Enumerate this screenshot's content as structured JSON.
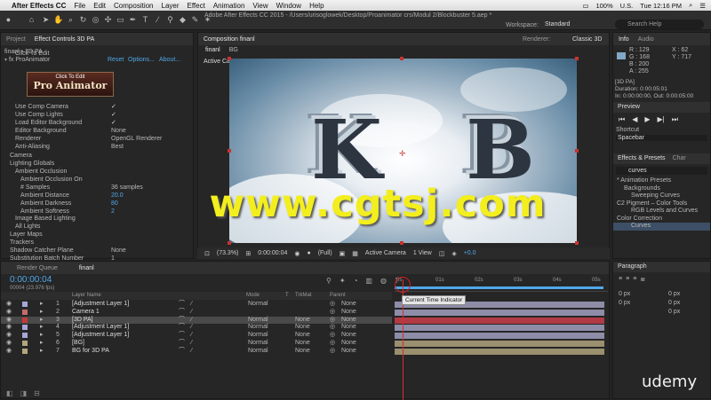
{
  "menubar": {
    "app": "After Effects CC",
    "items": [
      "File",
      "Edit",
      "Composition",
      "Layer",
      "Effect",
      "Animation",
      "View",
      "Window",
      "Help"
    ],
    "right": {
      "battery": "100%",
      "lang": "U.S.",
      "day_time": "Tue 12:16 PM"
    }
  },
  "toolbar": {
    "window_title": "Adobe After Effects CC 2015 - /Users/urisoglowek/Desktop/Proanimator crs/Modul 2/Blockbuster 5.aep *",
    "workspace_label": "Workspace:",
    "workspace_value": "Standard",
    "search_placeholder": "Search Help"
  },
  "left_panel": {
    "tab_project": "Project",
    "tab_effect_controls": "Effect Controls 3D PA",
    "layer_path": "finanl • 3D PA",
    "effect_name": "ProAnimator",
    "reset": "Reset",
    "options": "Options...",
    "about": "About...",
    "rows": [
      {
        "label": "Click To Edit",
        "value": ""
      },
      {
        "label": "Use Comp Camera",
        "value": "✓"
      },
      {
        "label": "Use Comp Lights",
        "value": "✓"
      },
      {
        "label": "Load Editor Background",
        "value": "✓"
      },
      {
        "label": "Editor Background",
        "value": "None"
      },
      {
        "label": "Renderer",
        "value": "OpenGL Renderer"
      },
      {
        "label": "Anti-Aliasing",
        "value": "Best"
      },
      {
        "label": "Camera",
        "value": ""
      },
      {
        "label": "Lighting Globals",
        "value": ""
      },
      {
        "label": "Ambient Occlusion",
        "value": ""
      },
      {
        "label": "Ambient Occlusion On",
        "value": ""
      },
      {
        "label": "# Samples",
        "value": "36 samples"
      },
      {
        "label": "Ambient Distance",
        "value": "20.0"
      },
      {
        "label": "Ambient Darkness",
        "value": "80"
      },
      {
        "label": "Ambient Softness",
        "value": "2"
      },
      {
        "label": "Image Based Lighting",
        "value": ""
      },
      {
        "label": "All Lights",
        "value": ""
      },
      {
        "label": "Layer Maps",
        "value": ""
      },
      {
        "label": "Trackers",
        "value": ""
      },
      {
        "label": "Shadow Catcher Plane",
        "value": "None"
      },
      {
        "label": "Substitution Batch Number",
        "value": "1"
      }
    ],
    "click_edit_top": "Click To Edit",
    "click_edit_logo": "Pro Animator"
  },
  "comp": {
    "tab_label": "Composition finanl",
    "view_tab": "finanl",
    "bg_tab": "BG",
    "active_camera": "Active Camera",
    "renderer_label": "Renderer:",
    "renderer_value": "Classic 3D",
    "footer": {
      "zoom": "(73.3%)",
      "time": "0:00:00:04",
      "res": "(Full)",
      "camera": "Active Camera",
      "views": "1 View",
      "exposure": "+0.0"
    },
    "letter_k": "K",
    "letter_b": "B",
    "watermark": "www.cgtsj.com"
  },
  "info": {
    "tab_info": "Info",
    "tab_audio": "Audio",
    "r": "R : 129",
    "g": "G : 168",
    "b": "B : 200",
    "a": "A : 255",
    "x": "X : 62",
    "y": "Y : 717",
    "layer": "[3D PA]",
    "duration": "Duration: 0:00:05:01",
    "inout": "In: 0:00:00:00, Out: 0:00:05:00",
    "color": "#81a8c8"
  },
  "preview": {
    "title": "Preview",
    "shortcut_label": "Shortcut",
    "shortcut_value": "Spacebar"
  },
  "effects": {
    "title": "Effects & Presets",
    "tab2": "Char",
    "search_value": "curves",
    "items": [
      {
        "label": "* Animation Presets",
        "indent": 0
      },
      {
        "label": "Backgrounds",
        "indent": 1
      },
      {
        "label": "Sweeping Curves",
        "indent": 2
      },
      {
        "label": "C2 Pigment – Color Tools",
        "indent": 0
      },
      {
        "label": "RGB Levels and Curves",
        "indent": 2
      },
      {
        "label": "Color Correction",
        "indent": 0
      },
      {
        "label": "Curves",
        "indent": 2
      }
    ]
  },
  "timeline": {
    "tab_render": "Render Queue",
    "tab_comp": "finanl",
    "time": "0:00:00:04",
    "frames": "00004 (23.976 fps)",
    "headers": {
      "layer_name": "Layer Name",
      "mode": "Mode",
      "t": "T",
      "trkmat": "TrkMat",
      "parent": "Parent"
    },
    "ruler": [
      "0s",
      "01s",
      "02s",
      "03s",
      "04s",
      "05s"
    ],
    "tooltip": "Current Time Indicator",
    "layers": [
      {
        "num": "1",
        "name": "[Adjustment Layer 1]",
        "mode": "Normal",
        "trkmat": "",
        "parent": "None",
        "color": "#a6a6d8",
        "track": "#8d8da8"
      },
      {
        "num": "2",
        "name": "Camera 1",
        "mode": "",
        "trkmat": "",
        "parent": "None",
        "color": "#c46b6b",
        "track": "#8d8da8"
      },
      {
        "num": "3",
        "name": "[3D PA]",
        "mode": "Normal",
        "trkmat": "None",
        "parent": "None",
        "color": "#c43a3a",
        "track": "#b23a45"
      },
      {
        "num": "4",
        "name": "[Adjustment Layer 1]",
        "mode": "Normal",
        "trkmat": "None",
        "parent": "None",
        "color": "#a6a6d8",
        "track": "#8d8da8"
      },
      {
        "num": "5",
        "name": "[Adjustment Layer 1]",
        "mode": "Normal",
        "trkmat": "None",
        "parent": "None",
        "color": "#a6a6d8",
        "track": "#8d8da8"
      },
      {
        "num": "6",
        "name": "[BG]",
        "mode": "Normal",
        "trkmat": "None",
        "parent": "None",
        "color": "#b5a67a",
        "track": "#9a8f6e"
      },
      {
        "num": "7",
        "name": "BG for 3D PA",
        "mode": "Normal",
        "trkmat": "None",
        "parent": "None",
        "color": "#b5a67a",
        "track": "#9a8f6e"
      }
    ]
  },
  "paragraph": {
    "title": "Paragraph",
    "values": [
      "0 px",
      "0 px",
      "0 px",
      "0 px",
      "0 px"
    ]
  },
  "brand": "udemy"
}
